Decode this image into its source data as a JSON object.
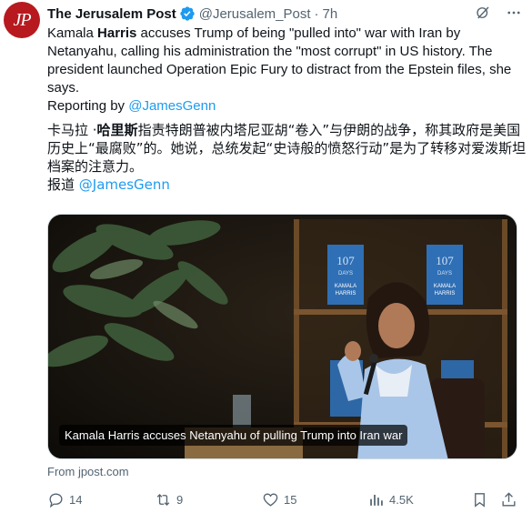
{
  "author": {
    "avatar_text": "JP",
    "name": "The Jerusalem Post",
    "handle": "@Jerusalem_Post",
    "separator": "·",
    "time": "7h"
  },
  "post": {
    "text_part1": "Kamala ",
    "text_bold": "Harris",
    "text_part2": " accuses Trump of being \"pulled into\" war with Iran by Netanyahu, calling his administration the \"most corrupt\" in US history. The president launched Operation Epic Fury to distract from the Epstein files, she says.",
    "reporting_label": "Reporting by ",
    "reporting_link": "@JamesGenn"
  },
  "translation": {
    "part1": "卡马拉 ·",
    "bold": "哈里斯",
    "part2": "指责特朗普被内塔尼亚胡“卷入”与伊朗的战争，称其政府是美国历史上“最腐败”的。她说，总统发起“史诗般的愤怒行动”是为了转移对爱泼斯坦档案的注意力。",
    "reporting_label": "报道 ",
    "reporting_link": "@JamesGenn"
  },
  "media": {
    "caption": "Kamala Harris accuses Netanyahu of pulling Trump into Iran war",
    "book_title_top": "107",
    "book_title_mid": "DAYS",
    "book_author_1": "KAMALA",
    "book_author_2": "HARRIS"
  },
  "source": "From jpost.com",
  "stats": {
    "replies": "14",
    "reposts": "9",
    "likes": "15",
    "views": "4.5K"
  },
  "colors": {
    "link": "#1d9bf0",
    "muted": "#536471",
    "avatar_bg": "#b7191f",
    "verified": "#1d9bf0"
  }
}
